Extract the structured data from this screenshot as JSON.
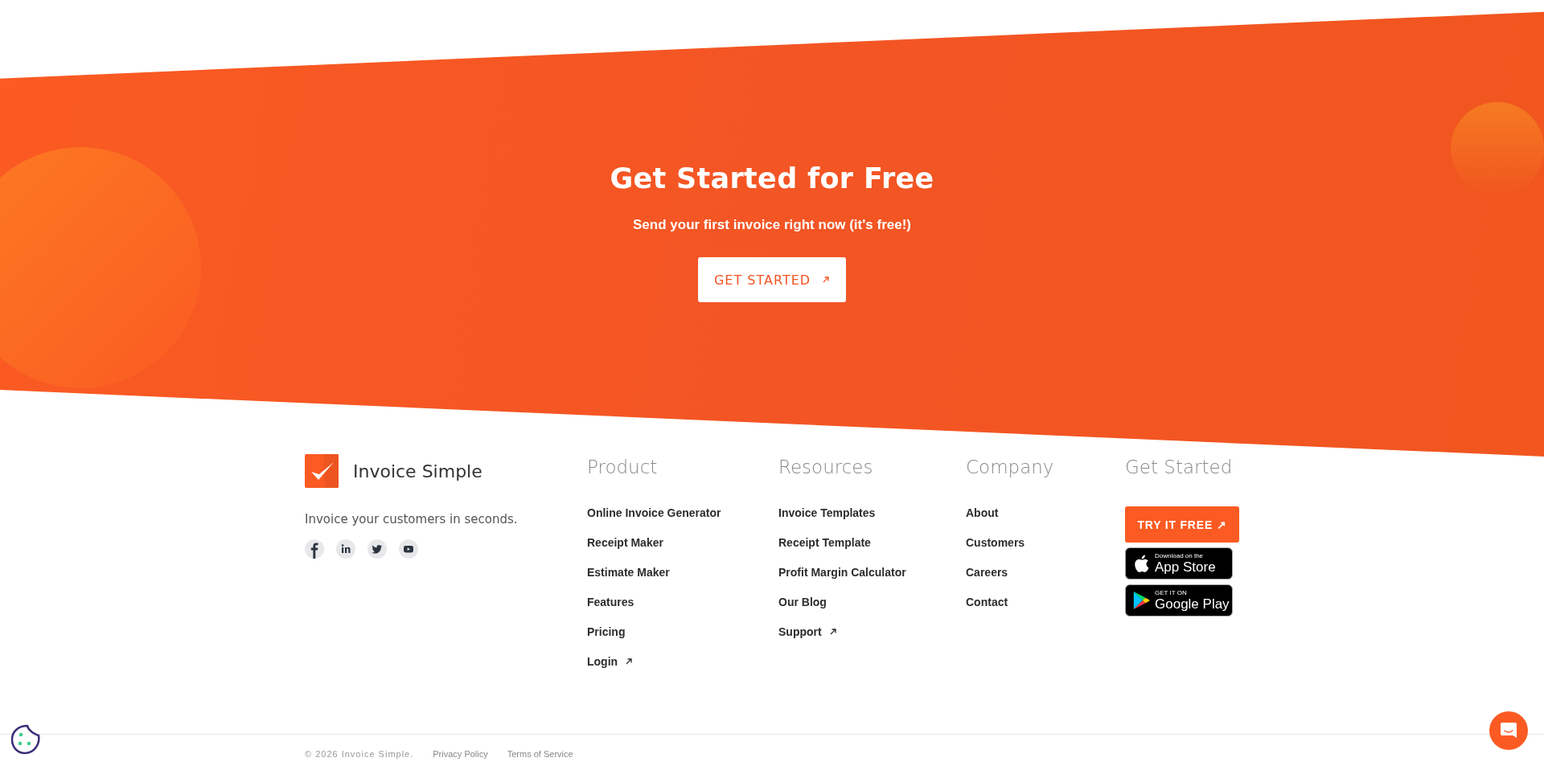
{
  "hero": {
    "title": "Get Started for Free",
    "subtitle": "Send your first invoice right now (it's free!)",
    "button": {
      "label": "GET STARTED",
      "external": true
    }
  },
  "brand": {
    "name": "Invoice Simple",
    "tagline": "Invoice your customers in seconds.",
    "social": [
      {
        "kind": "facebook"
      },
      {
        "kind": "linkedin"
      },
      {
        "kind": "twitter"
      },
      {
        "kind": "youtube"
      }
    ]
  },
  "columns": [
    {
      "heading": "Product",
      "links": [
        {
          "label": "Online Invoice Generator",
          "external": false
        },
        {
          "label": "Receipt Maker",
          "external": false
        },
        {
          "label": "Estimate Maker",
          "external": false
        },
        {
          "label": "Features",
          "external": false
        },
        {
          "label": "Pricing",
          "external": false
        },
        {
          "label": "Login",
          "external": true
        }
      ]
    },
    {
      "heading": "Resources",
      "links": [
        {
          "label": "Invoice Templates",
          "external": false
        },
        {
          "label": "Receipt Template",
          "external": false
        },
        {
          "label": "Profit Margin Calculator",
          "external": false
        },
        {
          "label": "Our Blog",
          "external": false
        },
        {
          "label": "Support",
          "external": true
        }
      ]
    },
    {
      "heading": "Company",
      "links": [
        {
          "label": "About",
          "external": false
        },
        {
          "label": "Customers",
          "external": false
        },
        {
          "label": "Careers",
          "external": false
        },
        {
          "label": "Contact",
          "external": false
        }
      ]
    }
  ],
  "get_started": {
    "heading": "Get Started",
    "button": "TRY IT FREE",
    "arrow": "↗",
    "badges": [
      {
        "kind": "apple",
        "small": "Download on the",
        "big": "App Store"
      },
      {
        "kind": "google",
        "small": "GET IT ON",
        "big": "Google Play"
      }
    ]
  },
  "bottom": {
    "copyright": "© 2026 Invoice Simple.",
    "links": [
      "Privacy Policy",
      "Terms of Service"
    ]
  }
}
